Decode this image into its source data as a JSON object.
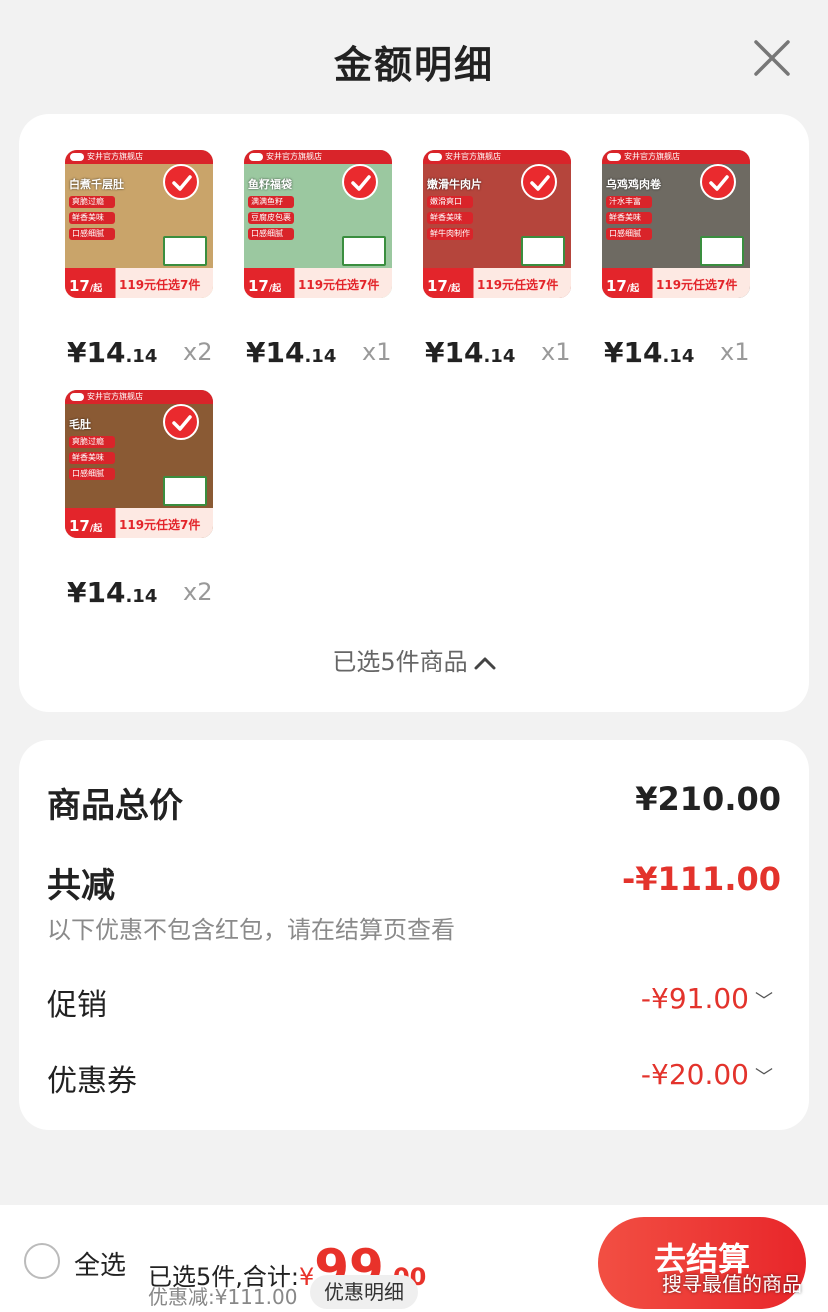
{
  "header": {
    "title": "金额明细"
  },
  "colors": {
    "accent": "#e8262a",
    "discount": "#e3332c"
  },
  "products": [
    {
      "name": "白煮千层肚",
      "store": "安井官方旗舰店",
      "tags": [
        "爽脆过瘾",
        "鲜香美味",
        "口感细腻"
      ],
      "promo_price": "17",
      "promo_unit": "/起",
      "promo_text": "119元任选7件",
      "price_main": "¥14",
      "price_dec": ".14",
      "qty": "x2",
      "bg": "#c9a46a"
    },
    {
      "name": "鱼籽福袋",
      "store": "安井官方旗舰店",
      "tags": [
        "满满鱼籽",
        "豆腐皮包裹",
        "口感细腻"
      ],
      "promo_price": "17",
      "promo_unit": "/起",
      "promo_text": "119元任选7件",
      "price_main": "¥14",
      "price_dec": ".14",
      "qty": "x1",
      "bg": "#9bc8a0"
    },
    {
      "name": "嫩滑牛肉片",
      "store": "安井官方旗舰店",
      "tags": [
        "嫩滑爽口",
        "鲜香美味",
        "鲜牛肉制作"
      ],
      "promo_price": "17",
      "promo_unit": "/起",
      "promo_text": "119元任选7件",
      "price_main": "¥14",
      "price_dec": ".14",
      "qty": "x1",
      "bg": "#b5453c"
    },
    {
      "name": "乌鸡鸡肉卷",
      "store": "安井官方旗舰店",
      "tags": [
        "汁水丰富",
        "鲜香美味",
        "口感细腻"
      ],
      "promo_price": "17",
      "promo_unit": "/起",
      "promo_text": "119元任选7件",
      "price_main": "¥14",
      "price_dec": ".14",
      "qty": "x1",
      "bg": "#6e6a62"
    },
    {
      "name": "毛肚",
      "store": "安井官方旗舰店",
      "tags": [
        "爽脆过瘾",
        "鲜香美味",
        "口感细腻"
      ],
      "promo_price": "17",
      "promo_unit": "/起",
      "promo_text": "119元任选7件",
      "price_main": "¥14",
      "price_dec": ".14",
      "qty": "x2",
      "bg": "#8a5a34"
    }
  ],
  "selected_summary": "已选5件商品",
  "summary": {
    "total_label": "商品总价",
    "total_value": "¥210.00",
    "reduce_label": "共减",
    "reduce_value": "-¥111.00",
    "note": "以下优惠不包含红包，请在结算页查看",
    "promo_label": "促销",
    "promo_value": "-¥91.00",
    "coupon_label": "优惠券",
    "coupon_value": "-¥20.00"
  },
  "bottom": {
    "select_all": "全选",
    "selected_prefix": "已选5件,合计:",
    "yen": "¥",
    "total_int": "99",
    "total_dec": ".00",
    "discount_text": "优惠减:¥111.00",
    "detail_chip": "优惠明细",
    "checkout": "去结算",
    "watermark": "搜寻最值的商品"
  }
}
